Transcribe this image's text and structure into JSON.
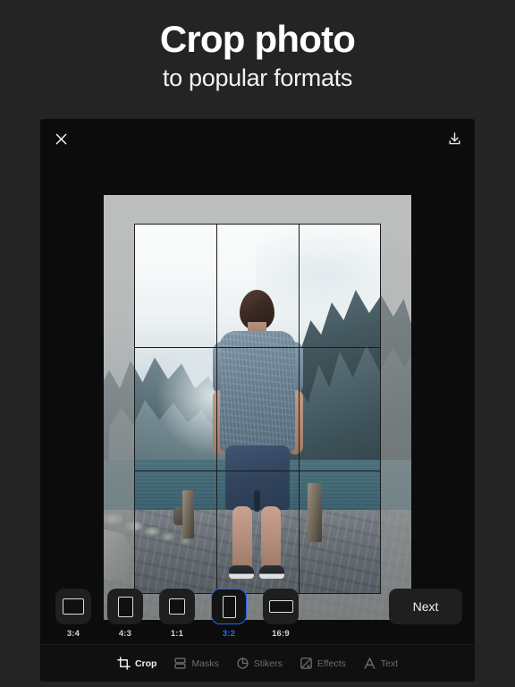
{
  "headline": {
    "title": "Crop photo",
    "subtitle": "to popular formats"
  },
  "colors": {
    "page_background": "#242424",
    "panel_background": "#0c0c0c",
    "accent_blue": "#2563f0",
    "label_text": "#d4d4d4",
    "toolbar_inactive": "#6d6d6d"
  },
  "app": {
    "topbar": {
      "close_icon": "close-icon",
      "download_icon": "download-icon"
    },
    "editor": {
      "grid_overlay": "rule-of-thirds",
      "photo_description": "Man standing on stone pier facing mountains and lake"
    },
    "ratios": {
      "items": [
        {
          "label": "3:4",
          "shape": "landscape",
          "selected": false
        },
        {
          "label": "4:3",
          "shape": "portrait",
          "selected": false
        },
        {
          "label": "1:1",
          "shape": "square",
          "selected": false
        },
        {
          "label": "3:2",
          "shape": "portrait-tall",
          "selected": true
        },
        {
          "label": "16:9",
          "shape": "wide",
          "selected": false
        }
      ],
      "next_label": "Next"
    },
    "toolbar": {
      "items": [
        {
          "label": "Crop",
          "icon": "crop-icon",
          "active": true
        },
        {
          "label": "Masks",
          "icon": "masks-icon",
          "active": false
        },
        {
          "label": "Stikers",
          "icon": "stickers-icon",
          "active": false
        },
        {
          "label": "Effects",
          "icon": "effects-icon",
          "active": false
        },
        {
          "label": "Text",
          "icon": "text-icon",
          "active": false
        }
      ]
    }
  }
}
